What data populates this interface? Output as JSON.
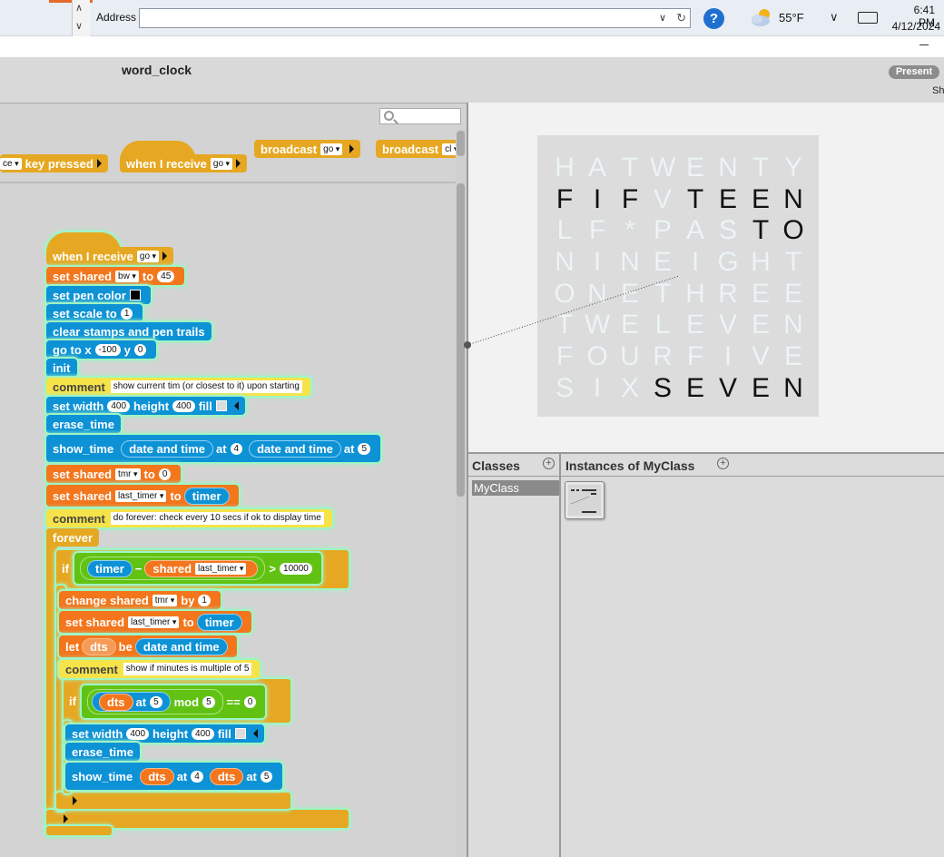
{
  "browser": {
    "address_label": "Address",
    "address_value": "",
    "weather_temp": "55°F",
    "clock_time": "6:41 PM",
    "clock_date": "4/12/2024"
  },
  "app": {
    "project_title": "word_clock",
    "present_label": "Present",
    "share_label": "Sh"
  },
  "palette": {
    "key_dropdown": "ce",
    "key_pressed": "key pressed",
    "when_receive": "when I receive",
    "when_receive_msg": "go",
    "broadcast_1": "broadcast",
    "broadcast_1_msg": "go",
    "broadcast_2": "broadcast",
    "broadcast_2_msg": "cl"
  },
  "script": {
    "hat_label": "when I receive",
    "hat_msg": "go",
    "b1_label": "set shared",
    "b1_var": "bw",
    "b1_to": "to",
    "b1_val": "45",
    "b2_label": "set pen color",
    "b3_label": "set scale to",
    "b3_val": "1",
    "b4_label": "clear stamps and pen trails",
    "b5_label": "go to x",
    "b5_x": "-100",
    "b5_y_label": "y",
    "b5_y": "0",
    "b6_label": "init",
    "c1_label": "comment",
    "c1_text": "show current tim (or closest to it) upon starting",
    "b7_label": "set width",
    "b7_w": "400",
    "b7_h_label": "height",
    "b7_h": "400",
    "b7_fill": "fill",
    "b8_label": "erase_time",
    "b9_label": "show_time",
    "b9_r1": "date and time",
    "b9_at1": "at",
    "b9_n1": "4",
    "b9_r2": "date and time",
    "b9_at2": "at",
    "b9_n2": "5",
    "b10_label": "set shared",
    "b10_var": "tmr",
    "b10_to": "to",
    "b10_val": "0",
    "b11_label": "set shared",
    "b11_var": "last_timer",
    "b11_to": "to",
    "b11_val": "timer",
    "c2_label": "comment",
    "c2_text": "do forever: check every 10 secs if ok to display time",
    "forever_label": "forever",
    "if1_label": "if",
    "if1_timer": "timer",
    "if1_minus": "−",
    "if1_shared": "shared",
    "if1_var": "last_timer",
    "if1_gt": ">",
    "if1_val": "10000",
    "b12_label": "change shared",
    "b12_var": "tmr",
    "b12_by": "by",
    "b12_val": "1",
    "b13_label": "set shared",
    "b13_var": "last_timer",
    "b13_to": "to",
    "b13_val": "timer",
    "b14_let": "let",
    "b14_var": "dts",
    "b14_be": "be",
    "b14_val": "date and time",
    "c3_label": "comment",
    "c3_text": "show if minutes is multiple of 5",
    "if2_label": "if",
    "if2_dts": "dts",
    "if2_at": "at",
    "if2_n": "5",
    "if2_mod": "mod",
    "if2_m": "5",
    "if2_eq": "==",
    "if2_val": "0",
    "b15_label": "set width",
    "b15_w": "400",
    "b15_h_label": "height",
    "b15_h": "400",
    "b15_fill": "fill",
    "b16_label": "erase_time",
    "b17_label": "show_time",
    "b17_r1": "dts",
    "b17_at1": "at",
    "b17_n1": "4",
    "b17_r2": "dts",
    "b17_at2": "at",
    "b17_n2": "5"
  },
  "word_grid": [
    [
      "H",
      "A",
      "T",
      "W",
      "E",
      "N",
      "T",
      "Y"
    ],
    [
      "F",
      "I",
      "F",
      "V",
      "T",
      "E",
      "E",
      "N"
    ],
    [
      "L",
      "F",
      "*",
      "P",
      "A",
      "S",
      "T",
      "O"
    ],
    [
      "N",
      "I",
      "N",
      "E",
      "I",
      "G",
      "H",
      "T"
    ],
    [
      "O",
      "N",
      "E",
      "T",
      "H",
      "R",
      "E",
      "E"
    ],
    [
      "T",
      "W",
      "E",
      "L",
      "E",
      "V",
      "E",
      "N"
    ],
    [
      "F",
      "O",
      "U",
      "R",
      "F",
      "I",
      "V",
      "E"
    ],
    [
      "S",
      "I",
      "X",
      "S",
      "E",
      "V",
      "E",
      "N"
    ]
  ],
  "lit_letters": [
    "1-0",
    "1-1",
    "1-2",
    "1-4",
    "1-5",
    "1-6",
    "1-7",
    "2-6",
    "2-7",
    "7-3",
    "7-4",
    "7-5",
    "7-6",
    "7-7"
  ],
  "panels": {
    "classes_title": "Classes",
    "classes_item": "MyClass",
    "instances_title": "Instances of MyClass"
  },
  "colors": {
    "control": "#e6a822",
    "variables": "#f3761d",
    "pen": "#0d92d6",
    "operators": "#62c213",
    "comment": "#f6e34a"
  }
}
